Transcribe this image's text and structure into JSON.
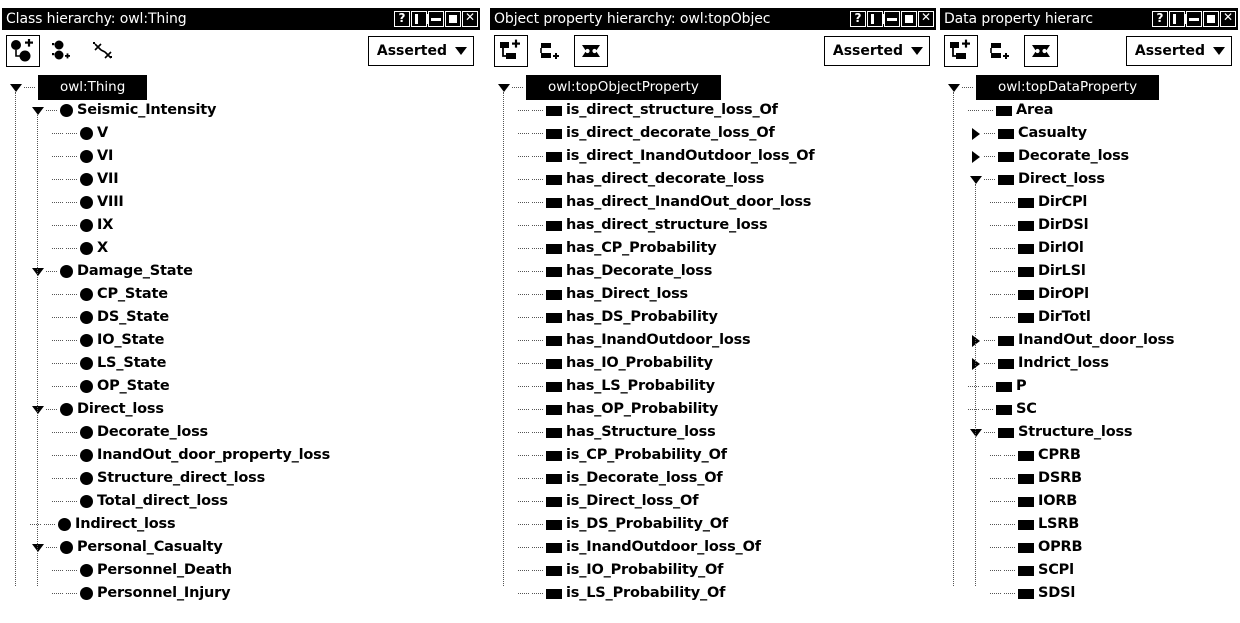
{
  "panels": [
    {
      "id": "class-hierarchy",
      "title": "Class hierarchy: owl:Thing",
      "window_buttons": [
        "help",
        "split",
        "minimize",
        "maximize",
        "close"
      ],
      "toolbar": {
        "buttons": [
          "add-subclass-icon",
          "add-sibling-class-icon",
          "delete-class-icon"
        ],
        "dropdown_value": "Asserted"
      },
      "icon_kind": "class",
      "root": {
        "label": "owl:Thing",
        "selected": true
      },
      "tree": [
        {
          "label": "Seismic_Intensity",
          "depth": 1,
          "twisty": "open"
        },
        {
          "label": "V",
          "depth": 2,
          "twisty": "none"
        },
        {
          "label": "VI",
          "depth": 2,
          "twisty": "none"
        },
        {
          "label": "VII",
          "depth": 2,
          "twisty": "none"
        },
        {
          "label": "VIII",
          "depth": 2,
          "twisty": "none"
        },
        {
          "label": "IX",
          "depth": 2,
          "twisty": "none"
        },
        {
          "label": "X",
          "depth": 2,
          "twisty": "none"
        },
        {
          "label": "Damage_State",
          "depth": 1,
          "twisty": "open"
        },
        {
          "label": "CP_State",
          "depth": 2,
          "twisty": "none"
        },
        {
          "label": "DS_State",
          "depth": 2,
          "twisty": "none"
        },
        {
          "label": "IO_State",
          "depth": 2,
          "twisty": "none"
        },
        {
          "label": "LS_State",
          "depth": 2,
          "twisty": "none"
        },
        {
          "label": "OP_State",
          "depth": 2,
          "twisty": "none"
        },
        {
          "label": "Direct_loss",
          "depth": 1,
          "twisty": "open"
        },
        {
          "label": "Decorate_loss",
          "depth": 2,
          "twisty": "none"
        },
        {
          "label": "InandOut_door_property_loss",
          "depth": 2,
          "twisty": "none"
        },
        {
          "label": "Structure_direct_loss",
          "depth": 2,
          "twisty": "none"
        },
        {
          "label": "Total_direct_loss",
          "depth": 2,
          "twisty": "none"
        },
        {
          "label": "Indirect_loss",
          "depth": 1,
          "twisty": "none"
        },
        {
          "label": "Personal_Casualty",
          "depth": 1,
          "twisty": "open"
        },
        {
          "label": "Personnel_Death",
          "depth": 2,
          "twisty": "none"
        },
        {
          "label": "Personnel_Injury",
          "depth": 2,
          "twisty": "none"
        }
      ]
    },
    {
      "id": "object-property-hierarchy",
      "title": "Object property hierarchy: owl:topObjec",
      "window_buttons": [
        "help",
        "split",
        "minimize",
        "maximize",
        "close"
      ],
      "toolbar": {
        "buttons": [
          "add-sub-property-icon",
          "add-sibling-property-icon",
          "delete-property-icon"
        ],
        "dropdown_value": "Asserted"
      },
      "icon_kind": "property",
      "root": {
        "label": "owl:topObjectProperty",
        "selected": true
      },
      "tree": [
        {
          "label": "is_direct_structure_loss_Of",
          "depth": 1,
          "twisty": "none"
        },
        {
          "label": "is_direct_decorate_loss_Of",
          "depth": 1,
          "twisty": "none"
        },
        {
          "label": "is_direct_InandOutdoor_loss_Of",
          "depth": 1,
          "twisty": "none"
        },
        {
          "label": "has_direct_decorate_loss",
          "depth": 1,
          "twisty": "none"
        },
        {
          "label": "has_direct_InandOut_door_loss",
          "depth": 1,
          "twisty": "none"
        },
        {
          "label": "has_direct_structure_loss",
          "depth": 1,
          "twisty": "none"
        },
        {
          "label": "has_CP_Probability",
          "depth": 1,
          "twisty": "none"
        },
        {
          "label": "has_Decorate_loss",
          "depth": 1,
          "twisty": "none"
        },
        {
          "label": "has_Direct_loss",
          "depth": 1,
          "twisty": "none"
        },
        {
          "label": "has_DS_Probability",
          "depth": 1,
          "twisty": "none"
        },
        {
          "label": "has_InandOutdoor_loss",
          "depth": 1,
          "twisty": "none"
        },
        {
          "label": "has_IO_Probability",
          "depth": 1,
          "twisty": "none"
        },
        {
          "label": "has_LS_Probability",
          "depth": 1,
          "twisty": "none"
        },
        {
          "label": "has_OP_Probability",
          "depth": 1,
          "twisty": "none"
        },
        {
          "label": "has_Structure_loss",
          "depth": 1,
          "twisty": "none"
        },
        {
          "label": "is_CP_Probability_Of",
          "depth": 1,
          "twisty": "none"
        },
        {
          "label": "is_Decorate_loss_Of",
          "depth": 1,
          "twisty": "none"
        },
        {
          "label": "is_Direct_loss_Of",
          "depth": 1,
          "twisty": "none"
        },
        {
          "label": "is_DS_Probability_Of",
          "depth": 1,
          "twisty": "none"
        },
        {
          "label": "is_InandOutdoor_loss_Of",
          "depth": 1,
          "twisty": "none"
        },
        {
          "label": "is_IO_Probability_Of",
          "depth": 1,
          "twisty": "none"
        },
        {
          "label": "is_LS_Probability_Of",
          "depth": 1,
          "twisty": "none"
        }
      ]
    },
    {
      "id": "data-property-hierarchy",
      "title": "Data property hierarc",
      "window_buttons": [
        "help",
        "split",
        "minimize",
        "maximize",
        "close"
      ],
      "toolbar": {
        "buttons": [
          "add-sub-property-icon",
          "add-sibling-property-icon",
          "delete-property-icon"
        ],
        "dropdown_value": "Asserted"
      },
      "icon_kind": "property",
      "root": {
        "label": "owl:topDataProperty",
        "selected": true
      },
      "tree": [
        {
          "label": "Area",
          "depth": 1,
          "twisty": "none"
        },
        {
          "label": "Casualty",
          "depth": 1,
          "twisty": "closed"
        },
        {
          "label": "Decorate_loss",
          "depth": 1,
          "twisty": "closed"
        },
        {
          "label": "Direct_loss",
          "depth": 1,
          "twisty": "open"
        },
        {
          "label": "DirCPl",
          "depth": 2,
          "twisty": "none"
        },
        {
          "label": "DirDSl",
          "depth": 2,
          "twisty": "none"
        },
        {
          "label": "DirIOl",
          "depth": 2,
          "twisty": "none"
        },
        {
          "label": "DirLSl",
          "depth": 2,
          "twisty": "none"
        },
        {
          "label": "DirOPl",
          "depth": 2,
          "twisty": "none"
        },
        {
          "label": "DirTotl",
          "depth": 2,
          "twisty": "none"
        },
        {
          "label": "InandOut_door_loss",
          "depth": 1,
          "twisty": "closed"
        },
        {
          "label": "Indrict_loss",
          "depth": 1,
          "twisty": "closed"
        },
        {
          "label": "P",
          "depth": 1,
          "twisty": "none"
        },
        {
          "label": "SC",
          "depth": 1,
          "twisty": "none"
        },
        {
          "label": "Structure_loss",
          "depth": 1,
          "twisty": "open"
        },
        {
          "label": "CPRB",
          "depth": 2,
          "twisty": "none"
        },
        {
          "label": "DSRB",
          "depth": 2,
          "twisty": "none"
        },
        {
          "label": "IORB",
          "depth": 2,
          "twisty": "none"
        },
        {
          "label": "LSRB",
          "depth": 2,
          "twisty": "none"
        },
        {
          "label": "OPRB",
          "depth": 2,
          "twisty": "none"
        },
        {
          "label": "SCPl",
          "depth": 2,
          "twisty": "none"
        },
        {
          "label": "SDSl",
          "depth": 2,
          "twisty": "none"
        }
      ]
    }
  ],
  "colors": {
    "background": "#ffffff",
    "foreground": "#000000",
    "selection_bg": "#000000",
    "selection_fg": "#ffffff",
    "guide_line": "#555555"
  }
}
